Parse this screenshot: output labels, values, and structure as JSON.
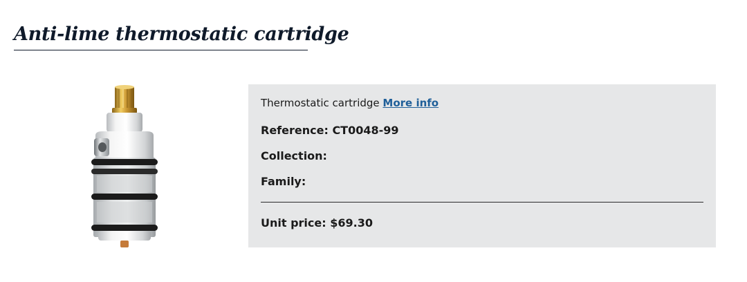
{
  "product": {
    "title": "Anti-lime thermostatic cartridge",
    "image_icon": "thermostatic-cartridge-photo"
  },
  "info": {
    "description": "Thermostatic cartridge",
    "more_info_link": "More info",
    "reference_label": "Reference:",
    "reference_value": "CT0048-99",
    "collection_label": "Collection:",
    "collection_value": "",
    "family_label": "Family:",
    "family_value": "",
    "price_label": "Unit price:",
    "price_value": "$69.30"
  },
  "colors": {
    "panel_background": "#e6e7e8",
    "link": "#1f5f99",
    "title": "#0f1a2a"
  }
}
